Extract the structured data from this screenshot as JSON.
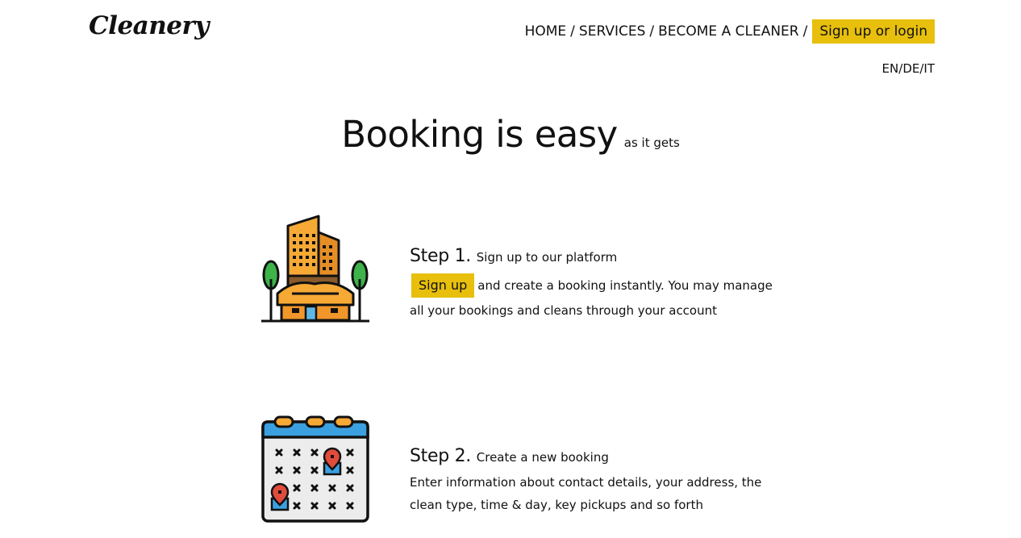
{
  "brand": {
    "logo_text": "Cleanery"
  },
  "nav": {
    "items": [
      {
        "label": "HOME"
      },
      {
        "label": "SERVICES"
      },
      {
        "label": "BECOME A CLEANER"
      }
    ],
    "separator": "/",
    "cta_label": "Sign up or login"
  },
  "language": {
    "options": [
      "EN",
      "DE",
      "IT"
    ],
    "separator": "/"
  },
  "hero": {
    "title": "Booking is easy",
    "subtitle": "as it gets"
  },
  "steps": [
    {
      "title": "Step 1.",
      "subtitle": "Sign up to our platform",
      "button_label": "Sign up",
      "description": "and create a booking instantly. You may manage all your bookings and cleans through your account",
      "icon": "buildings-icon"
    },
    {
      "title": "Step 2.",
      "subtitle": "Create a new booking",
      "description": "Enter information about contact details, your address, the clean type, time & day, key pickups and so forth",
      "icon": "calendar-icon"
    }
  ],
  "colors": {
    "accent": "#e7bf0c",
    "text": "#111111",
    "background": "#ffffff"
  }
}
